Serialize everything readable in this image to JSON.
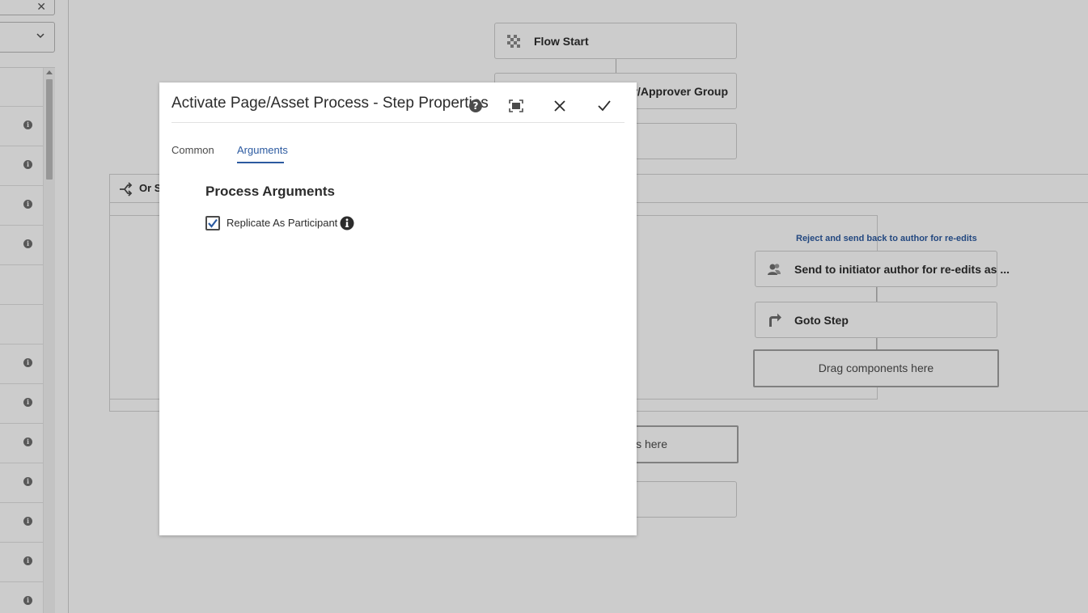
{
  "sidebar": {
    "search_clear_icon": "close-icon",
    "select_icon": "chevron-down-icon",
    "rows_with_info_icon": 12,
    "info_glyph": "i"
  },
  "canvas": {
    "nodes": {
      "flow_start": "Flow Start",
      "approver_group_partial": "er/Approver Group",
      "or_split_partial": "Or S",
      "reject_branch_link": "Reject and send back to author for re-edits",
      "send_to_initiator": "Send to initiator author for re-edits as ...",
      "goto_step": "Goto Step",
      "drag_components": "Drag components here",
      "drag_components_partial": "ts here"
    }
  },
  "dialog": {
    "title": "Activate Page/Asset Process - Step Properties",
    "tabs": [
      {
        "label": "Common",
        "active": false
      },
      {
        "label": "Arguments",
        "active": true
      }
    ],
    "section_title": "Process Arguments",
    "checkbox": {
      "label": "Replicate As Participant",
      "checked": true
    },
    "buttons": {
      "help": "help-icon",
      "fullscreen": "fullscreen-icon",
      "close": "close-icon",
      "done": "checkmark-icon"
    }
  },
  "colors": {
    "accent": "#2c5aa0",
    "overlay": "rgba(0,0,0,0.2)",
    "text": "#2c2c2c"
  }
}
